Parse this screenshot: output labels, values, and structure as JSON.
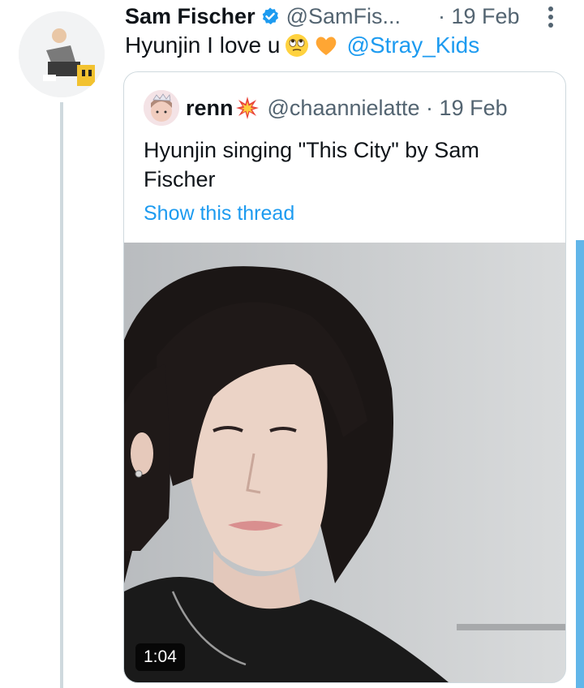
{
  "tweet": {
    "author_name": "Sam Fischer",
    "handle": "@SamFis...",
    "time": "· 19 Feb",
    "text": "Hyunjin I love u",
    "mention": "@Stray_Kids",
    "emojis": [
      "rolling-eyes-emoji",
      "orange-heart-emoji"
    ]
  },
  "quote": {
    "author_name": "renn",
    "handle": "@chaannielatte · 19 Feb",
    "text": "Hyunjin singing \"This City\" by Sam Fischer",
    "show_thread": "Show this thread",
    "video_duration": "1:04"
  },
  "colors": {
    "link": "#1d9bf0",
    "secondary_text": "#536471",
    "border": "#cfd9de",
    "scroll_indicator": "#61b6e9"
  }
}
